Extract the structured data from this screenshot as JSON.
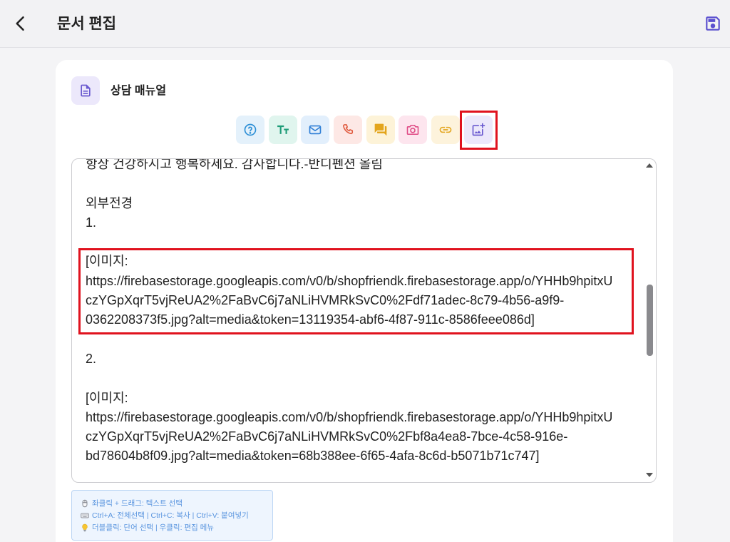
{
  "header": {
    "title": "문서 편집",
    "back_icon": "chevron-left-icon",
    "save_icon": "save-icon"
  },
  "document": {
    "title": "상담 매뉴얼",
    "icon": "document-icon",
    "icon_color": "#6a5ad0",
    "icon_background": "#ece8fb"
  },
  "toolbar": {
    "buttons": [
      {
        "icon": "help-circle-icon",
        "color": "#2d8fd6",
        "background": "#e4f1fb"
      },
      {
        "icon": "text-size-icon",
        "color": "#1f9c78",
        "background": "#e0f5ee"
      },
      {
        "icon": "mail-icon",
        "color": "#2f7fd6",
        "background": "#e2effc"
      },
      {
        "icon": "phone-icon",
        "color": "#e05a3e",
        "background": "#fde8e5"
      },
      {
        "icon": "chat-icon",
        "color": "#e3a51c",
        "background": "#fdf3d8"
      },
      {
        "icon": "camera-icon",
        "color": "#e04b86",
        "background": "#fde5ee"
      },
      {
        "icon": "link-icon",
        "color": "#e3a51c",
        "background": "#fdf3dc"
      },
      {
        "icon": "add-image-icon",
        "color": "#6a5ad0",
        "background": "#ece8fb"
      }
    ]
  },
  "editor": {
    "lines": [
      "항상 건강하시고 행복하세요. 감사합니다.-반디펜션 올림",
      "",
      "외부전경",
      "1.",
      "",
      "[이미지:",
      "https://firebasestorage.googleapis.com/v0/b/shopfriendk.firebasestorage.app/o/YHHb9hpitxU",
      "czYGpXqrT5vjReUA2%2FaBvC6j7aNLiHVMRkSvC0%2Fdf71adec-8c79-4b56-a9f9-",
      "0362208373f5.jpg?alt=media&token=13119354-abf6-4f87-911c-8586feee086d]",
      "",
      "2.",
      "",
      "[이미지:",
      "https://firebasestorage.googleapis.com/v0/b/shopfriendk.firebasestorage.app/o/YHHb9hpitxU",
      "czYGpXqrT5vjReUA2%2FaBvC6j7aNLiHVMRkSvC0%2Fbf8a4ea8-7bce-4c58-916e-",
      "bd78604b8f09.jpg?alt=media&token=68b388ee-6f65-4afa-8c6d-b5071b71c747]"
    ]
  },
  "help": {
    "text_color": "#5a95df",
    "items": [
      {
        "icon": "mouse-icon",
        "text": "좌클릭 + 드래그: 텍스트 선택"
      },
      {
        "icon": "keyboard-icon",
        "text": "Ctrl+A: 전체선택 | Ctrl+C: 복사 | Ctrl+V: 붙여넣기"
      },
      {
        "icon": "lightbulb-icon",
        "text": "더블클릭: 단어 선택 | 우클릭: 편집 메뉴"
      }
    ]
  },
  "colors": {
    "accent": "#5a4fcf",
    "highlight_outline": "#e0121e"
  }
}
